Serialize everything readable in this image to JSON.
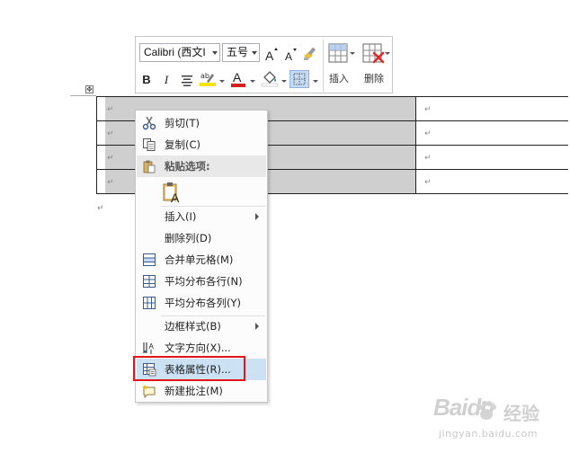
{
  "toolbar": {
    "font_name": "Calibri (西文I",
    "font_size": "五号",
    "bold": "B",
    "italic": "I",
    "font_color_letter": "A",
    "insert_label": "插入",
    "delete_label": "删除",
    "highlight_color": "#f5e400",
    "font_color": "#d32020"
  },
  "context_menu": {
    "items": [
      {
        "label": "剪切(T)",
        "icon": "scissors-icon"
      },
      {
        "label": "复制(C)",
        "icon": "copy-icon"
      },
      {
        "label": "粘贴选项:",
        "icon": "paste-icon"
      },
      {
        "label": "插入(I)",
        "icon": "",
        "submenu": true
      },
      {
        "label": "删除列(D)",
        "icon": ""
      },
      {
        "label": "合并单元格(M)",
        "icon": "merge-cells-icon"
      },
      {
        "label": "平均分布各行(N)",
        "icon": "distribute-rows-icon"
      },
      {
        "label": "平均分布各列(Y)",
        "icon": "distribute-columns-icon"
      },
      {
        "label": "边框样式(B)",
        "icon": "",
        "submenu": true
      },
      {
        "label": "文字方向(X)...",
        "icon": "text-direction-icon"
      },
      {
        "label": "表格属性(R)...",
        "icon": "table-properties-icon",
        "highlighted": true
      },
      {
        "label": "新建批注(M)",
        "icon": "new-comment-icon"
      }
    ]
  },
  "document": {
    "paragraph_mark": "↵",
    "move_handle": "✥"
  },
  "watermark": {
    "brand": "Baidu",
    "sub": "经验",
    "url": "jingyan.baidu.com"
  },
  "colors": {
    "selection": "#cfcfcf",
    "highlight_box": "#e3151a",
    "menu_hover": "#cde1f5"
  }
}
